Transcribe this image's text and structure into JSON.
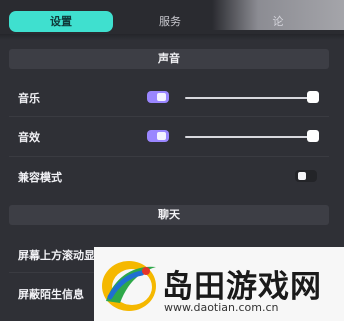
{
  "tabs": [
    {
      "label": "设置",
      "active": true
    },
    {
      "label": "服务",
      "active": false
    },
    {
      "label": "论",
      "active": false
    }
  ],
  "sections": {
    "sound": {
      "title": "声音"
    },
    "chat": {
      "title": "聊天"
    }
  },
  "settings": {
    "music": {
      "label": "音乐",
      "enabled": true,
      "volume_percent": 100
    },
    "sfx": {
      "label": "音效",
      "enabled": true,
      "volume_percent": 100
    },
    "compat_mode": {
      "label": "兼容模式",
      "enabled": false
    },
    "scroll_chat": {
      "label": "屏幕上方滚动显示聊天消息",
      "enabled": true
    },
    "block_strangers": {
      "label": "屏蔽陌生信息"
    }
  },
  "watermark": {
    "title": "岛田游戏网",
    "url": "www.daotian.com.cn"
  },
  "colors": {
    "accent_tab": "#3fe0cf",
    "toggle_on": "#9a86ff",
    "background": "#2f3036"
  }
}
